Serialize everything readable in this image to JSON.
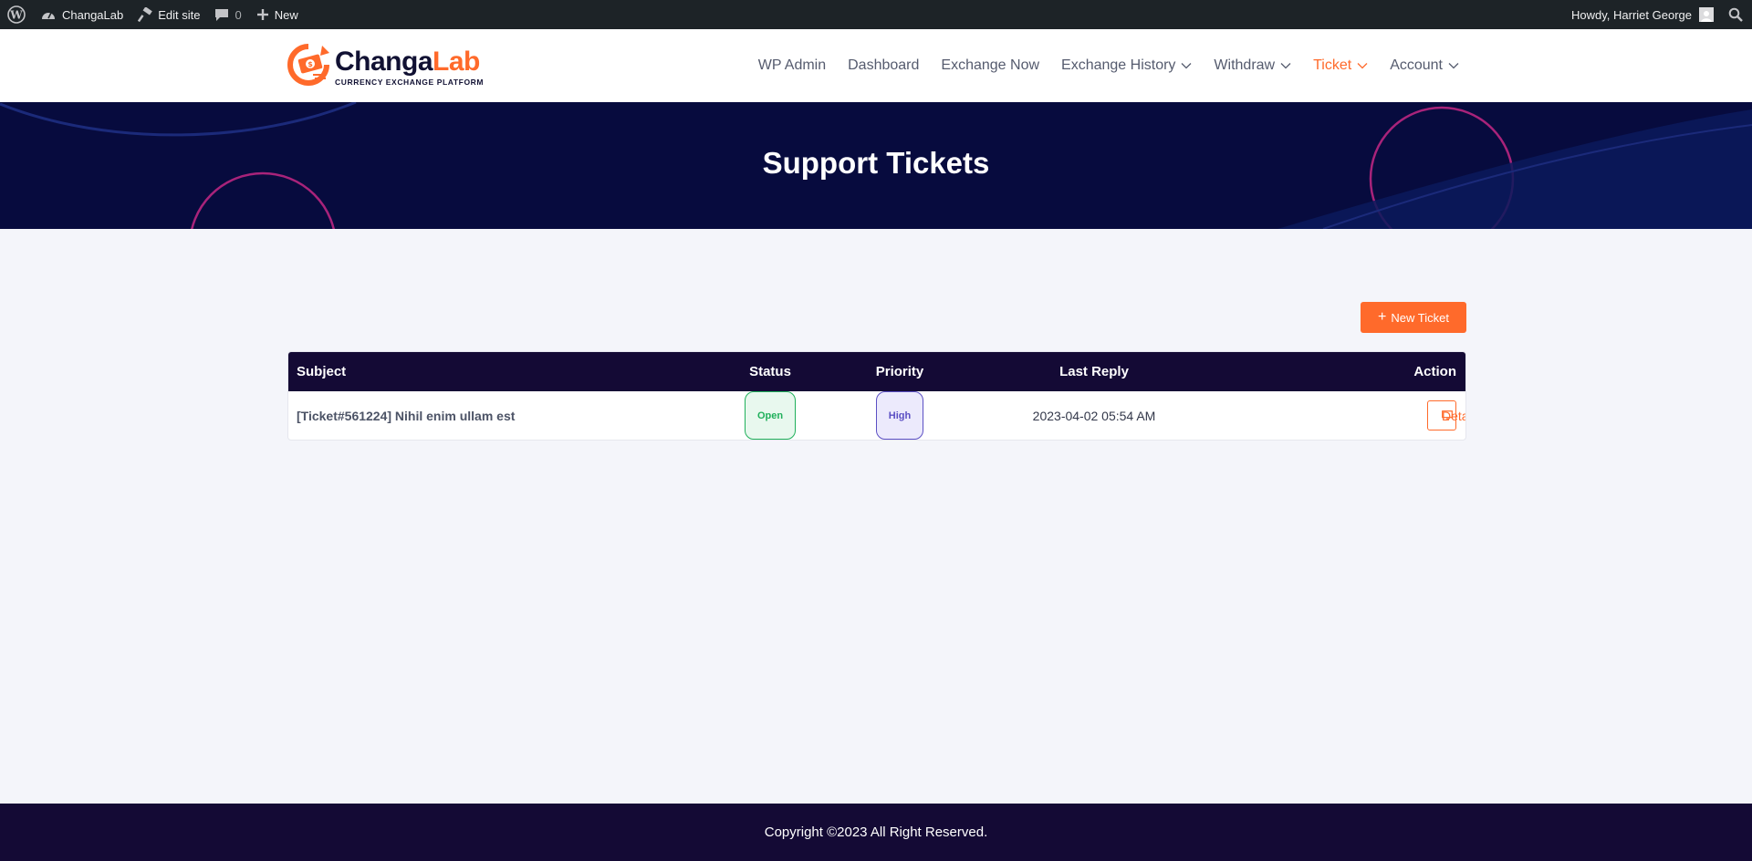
{
  "adminbar": {
    "site_name": "ChangaLab",
    "edit_site": "Edit site",
    "comments_count": "0",
    "new_label": "New",
    "howdy": "Howdy, Harriet George"
  },
  "header": {
    "logo_name_1": "Changa",
    "logo_name_2": "Lab",
    "logo_tagline": "CURRENCY EXCHANGE PLATFORM",
    "nav": [
      {
        "label": "WP Admin"
      },
      {
        "label": "Dashboard"
      },
      {
        "label": "Exchange Now"
      },
      {
        "label": "Exchange History"
      },
      {
        "label": "Withdraw"
      },
      {
        "label": "Ticket"
      },
      {
        "label": "Account"
      }
    ],
    "active_color": "#ff6a2b"
  },
  "hero": {
    "title": "Support Tickets"
  },
  "content": {
    "new_ticket_label": "New Ticket",
    "table": {
      "columns": [
        "Subject",
        "Status",
        "Priority",
        "Last Reply",
        "Action"
      ],
      "rows": [
        {
          "subject": "[Ticket#561224] Nihil enim ullam est",
          "status": "Open",
          "priority": "High",
          "last_reply": "2023-04-02 05:54 AM",
          "action": "Details"
        }
      ]
    }
  },
  "footer": {
    "copyright": "Copyright ©2023 All Right Reserved."
  },
  "colors": {
    "accent": "#ff6a2b",
    "hero_bg": "#070b3e",
    "table_header_bg": "#140a35",
    "status_open": "#20b05b",
    "priority_high": "#5b4fc4"
  }
}
